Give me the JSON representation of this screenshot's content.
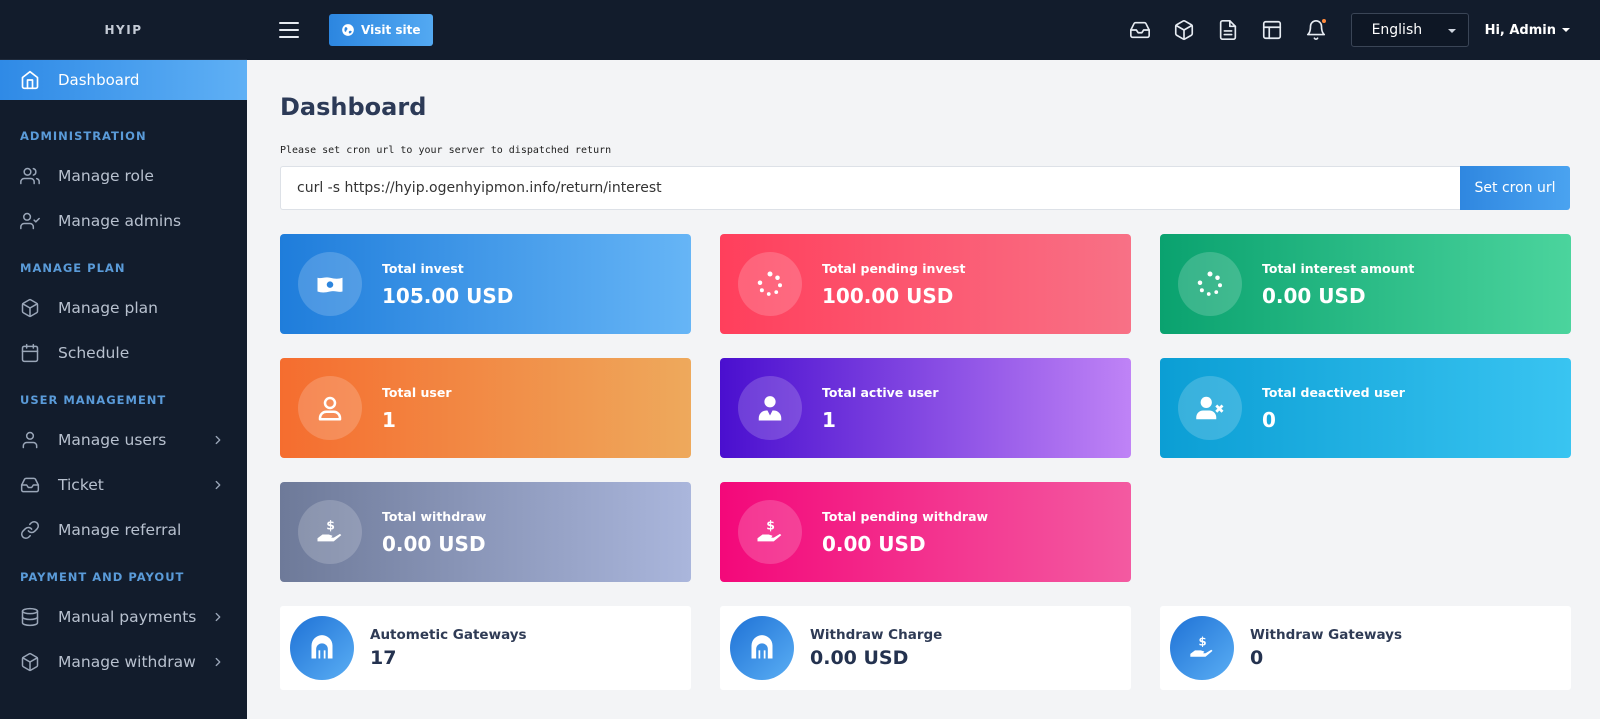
{
  "brand": "HYIP",
  "sidebar": {
    "active": "Dashboard",
    "sections": [
      {
        "title": "ADMINISTRATION",
        "items": [
          {
            "label": "Manage role",
            "icon": "users-icon",
            "chevron": false
          },
          {
            "label": "Manage admins",
            "icon": "user-check-icon",
            "chevron": false
          }
        ]
      },
      {
        "title": "MANAGE PLAN",
        "items": [
          {
            "label": "Manage plan",
            "icon": "box-icon",
            "chevron": false
          },
          {
            "label": "Schedule",
            "icon": "calendar-icon",
            "chevron": false
          }
        ]
      },
      {
        "title": "USER MANAGEMENT",
        "items": [
          {
            "label": "Manage users",
            "icon": "user-icon",
            "chevron": true
          },
          {
            "label": "Ticket",
            "icon": "inbox-icon",
            "chevron": true
          },
          {
            "label": "Manage referral",
            "icon": "link-icon",
            "chevron": false
          }
        ]
      },
      {
        "title": "PAYMENT AND PAYOUT",
        "items": [
          {
            "label": "Manual payments",
            "icon": "database-icon",
            "chevron": true
          },
          {
            "label": "Manage withdraw",
            "icon": "box-icon",
            "chevron": true
          }
        ]
      }
    ]
  },
  "topbar": {
    "visit_site": "Visit site",
    "language": "English",
    "user_greeting": "Hi, Admin",
    "icons": [
      "inbox-icon",
      "box-icon",
      "file-text-icon",
      "layout-icon",
      "bell-icon"
    ]
  },
  "main": {
    "title": "Dashboard",
    "cron_note": "Please set cron url to your server to dispatched return",
    "cron_value": "curl -s https://hyip.ogenhyipmon.info/return/interest",
    "cron_button": "Set cron url"
  },
  "cards": [
    {
      "label": "Total invest",
      "value": "105.00 USD",
      "icon": "money-icon"
    },
    {
      "label": "Total pending invest",
      "value": "100.00 USD",
      "icon": "spinner-icon"
    },
    {
      "label": "Total interest amount",
      "value": "0.00 USD",
      "icon": "spinner-icon"
    },
    {
      "label": "Total user",
      "value": "1",
      "icon": "user-icon"
    },
    {
      "label": "Total active user",
      "value": "1",
      "icon": "user-tie-icon"
    },
    {
      "label": "Total deactived user",
      "value": "0",
      "icon": "user-times-icon"
    },
    {
      "label": "Total withdraw",
      "value": "0.00 USD",
      "icon": "hand-dollar-icon"
    },
    {
      "label": "Total pending withdraw",
      "value": "0.00 USD",
      "icon": "hand-dollar-icon"
    }
  ],
  "stats": [
    {
      "label": "Autometic Gateways",
      "value": "17",
      "icon": "archway-icon"
    },
    {
      "label": "Withdraw Charge",
      "value": "0.00 USD",
      "icon": "archway-icon"
    },
    {
      "label": "Withdraw Gateways",
      "value": "0",
      "icon": "hand-dollar-icon"
    }
  ],
  "colors": {
    "sidebar_bg": "#121c2c",
    "accent": "#2f8ae6",
    "section_title": "#5a9bd9"
  }
}
